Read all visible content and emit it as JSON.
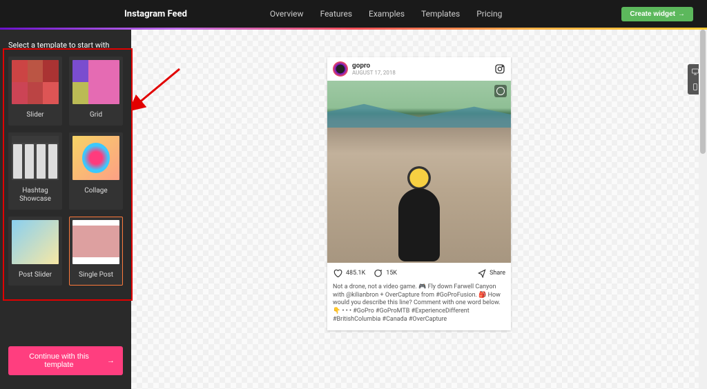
{
  "header": {
    "brand": "Instagram Feed",
    "nav": [
      "Overview",
      "Features",
      "Examples",
      "Templates",
      "Pricing"
    ],
    "create_label": "Create widget"
  },
  "sidebar": {
    "title": "Select a template to start with",
    "templates": [
      {
        "label": "Slider"
      },
      {
        "label": "Grid"
      },
      {
        "label": "Hashtag Showcase"
      },
      {
        "label": "Collage"
      },
      {
        "label": "Post Slider"
      },
      {
        "label": "Single Post"
      }
    ],
    "continue_label": "Continue with this template"
  },
  "post": {
    "user": "gopro",
    "date": "AUGUST 17, 2018",
    "likes": "485.1K",
    "comments": "15K",
    "share": "Share",
    "caption": "Not a drone, not a video game. 🎮 Fly down Farwell Canyon with @kilianbron + OverCapture from #GoProFusion. 🎒 How would you describe this line? Comment with one word below. 👇 • • • #GoPro #GoProMTB #ExperienceDifferent #BritishColumbia #Canada #OverCapture"
  }
}
